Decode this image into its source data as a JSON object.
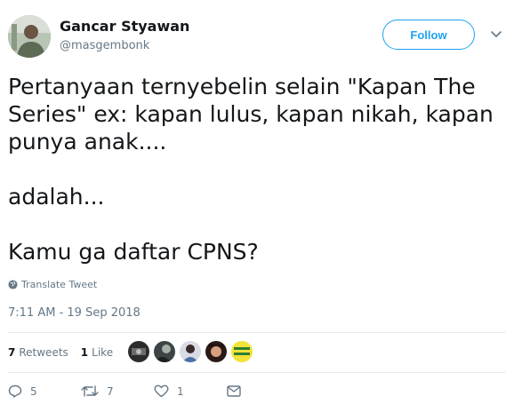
{
  "header": {
    "display_name": "Gancar Styawan",
    "handle": "@masgembonk",
    "follow_label": "Follow"
  },
  "tweet": {
    "text": "Pertanyaan ternyebelin selain \"Kapan The Series\" ex: kapan lulus, kapan nikah, kapan punya anak....\n\nadalah...\n\nKamu ga daftar CPNS?",
    "translate_label": "Translate Tweet",
    "timestamp": "7:11 AM - 19 Sep 2018"
  },
  "stats": {
    "retweets_count": "7",
    "retweets_label": "Retweets",
    "likes_count": "1",
    "likes_label": "Like"
  },
  "likers": [
    {
      "icon": "avatar-1"
    },
    {
      "icon": "avatar-2"
    },
    {
      "icon": "avatar-3"
    },
    {
      "icon": "avatar-4"
    },
    {
      "icon": "avatar-5"
    }
  ],
  "actions": {
    "reply_count": "5",
    "retweet_count": "7",
    "like_count": "1"
  },
  "colors": {
    "accent": "#1da1f2",
    "muted": "#657786",
    "text": "#14171a",
    "divider": "#e6ecf0"
  }
}
